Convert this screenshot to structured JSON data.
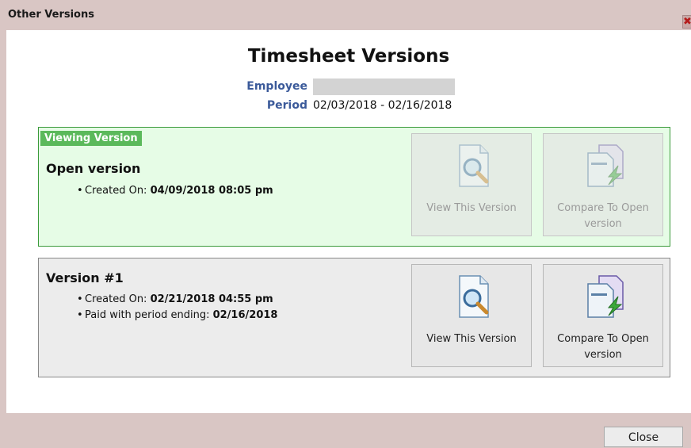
{
  "dialog": {
    "title": "Other Versions",
    "close_glyph": "✖",
    "close_button_label": "Close"
  },
  "header": {
    "heading": "Timesheet Versions",
    "employee_label": "Employee",
    "employee_value": "",
    "period_label": "Period",
    "period_value": "02/03/2018 - 02/16/2018"
  },
  "versions": [
    {
      "badge": "Viewing Version",
      "title": "Open version",
      "created_label": "Created On:",
      "created_value": "04/09/2018 08:05 pm",
      "view_label": "View This Version",
      "compare_label": "Compare To Open version",
      "buttons_enabled": false
    },
    {
      "title": "Version #1",
      "created_label": "Created On:",
      "created_value": "02/21/2018 04:55 pm",
      "paid_label": "Paid with period ending:",
      "paid_value": "02/16/2018",
      "view_label": "View This Version",
      "compare_label": "Compare To Open version",
      "buttons_enabled": true
    }
  ],
  "icons": {
    "view": "document-magnifier-icon",
    "compare": "document-compare-icon"
  },
  "colors": {
    "current_panel_bg": "#e6fce6",
    "current_panel_border": "#3a9a3a",
    "badge_bg": "#5bb95b",
    "label_blue": "#3b5a9a",
    "old_panel_bg": "#ececec"
  }
}
